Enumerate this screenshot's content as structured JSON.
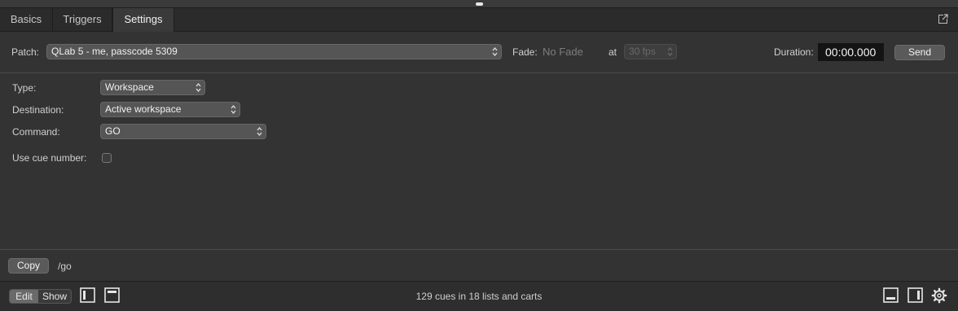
{
  "tabs": [
    {
      "label": "Basics"
    },
    {
      "label": "Triggers"
    },
    {
      "label": "Settings"
    }
  ],
  "patch": {
    "label": "Patch:",
    "value": "QLab 5 - me, passcode 5309",
    "fade_label": "Fade:",
    "fade_value": "No Fade",
    "at_label": "at",
    "fps_value": "30 fps",
    "duration_label": "Duration:",
    "duration_value": "00:00.000",
    "send_label": "Send"
  },
  "settings": {
    "type_label": "Type:",
    "type_value": "Workspace",
    "destination_label": "Destination:",
    "destination_value": "Active workspace",
    "command_label": "Command:",
    "command_value": "GO",
    "use_cue_number_label": "Use cue number:",
    "use_cue_number_checked": false
  },
  "osc": {
    "copy_label": "Copy",
    "address": "/go"
  },
  "statusbar": {
    "edit_label": "Edit",
    "show_label": "Show",
    "mode": "Edit",
    "summary": "129 cues in 18 lists and carts"
  },
  "icons": {
    "popout": "popout-icon",
    "left_sidebar": "left-sidebar-icon",
    "top_panel": "top-panel-icon",
    "bottom_panel": "bottom-panel-icon",
    "right_sidebar": "right-sidebar-icon",
    "settings": "gear-icon"
  },
  "colors": {
    "background": "#333333",
    "duration_field": "#141414",
    "active_tab": "#3a3a3a"
  }
}
